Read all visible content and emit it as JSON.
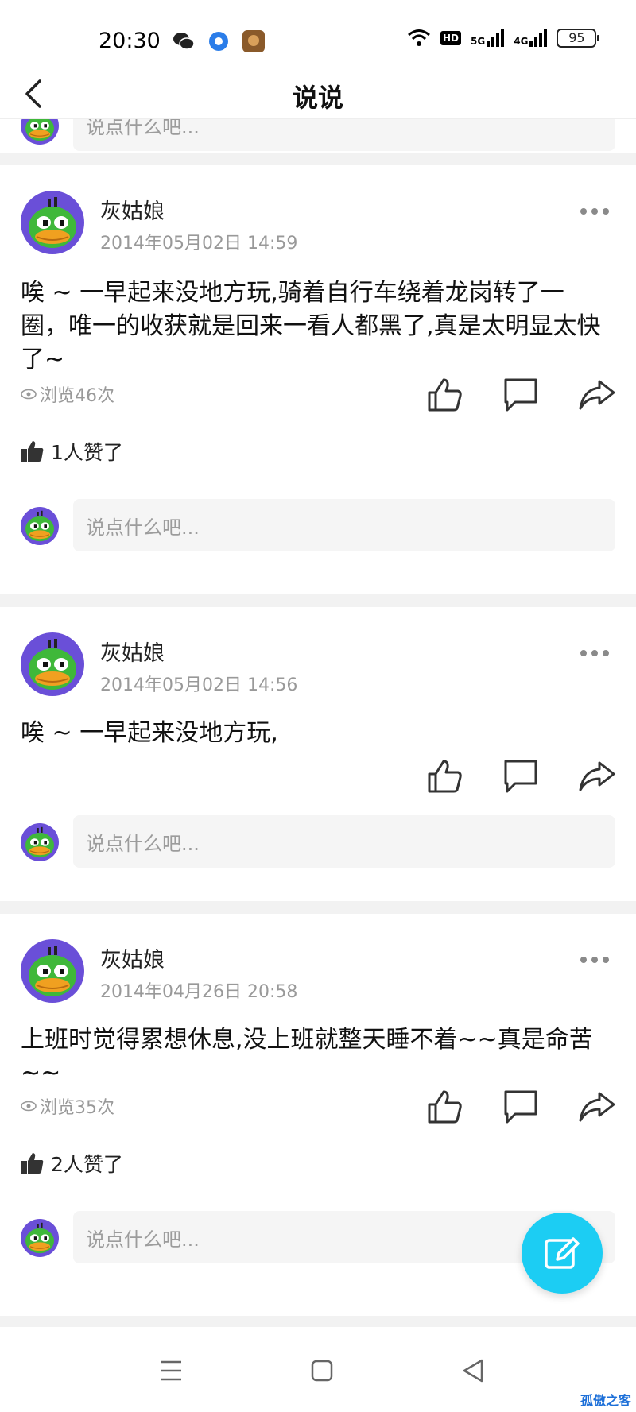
{
  "status_bar": {
    "time": "20:30",
    "network_labels": [
      "HD",
      "5G",
      "4G"
    ],
    "battery": "95"
  },
  "header": {
    "title": "说说"
  },
  "comment_placeholder": "说点什么吧...",
  "posts": [
    {
      "author": "灰姑娘",
      "time": "2014年05月02日 14:59",
      "text": "唉 ~ 一早起来没地方玩,骑着自行车绕着龙岗转了一圈，唯一的收获就是回来一看人都黑了,真是太明显太快了~",
      "views": "浏览46次",
      "likes": "1人赞了"
    },
    {
      "author": "灰姑娘",
      "time": "2014年05月02日 14:56",
      "text": "唉 ~ 一早起来没地方玩,"
    },
    {
      "author": "灰姑娘",
      "time": "2014年04月26日 20:58",
      "text": "上班时觉得累想休息,没上班就整天睡不着~~真是命苦~~",
      "views": "浏览35次",
      "likes": "2人赞了"
    }
  ],
  "watermark": "孤傲之客",
  "colors": {
    "accent": "#1ccdf3",
    "avatar_bg": "#6a4fd8",
    "duck_green": "#3fb83a",
    "duck_beak": "#f0a020"
  }
}
